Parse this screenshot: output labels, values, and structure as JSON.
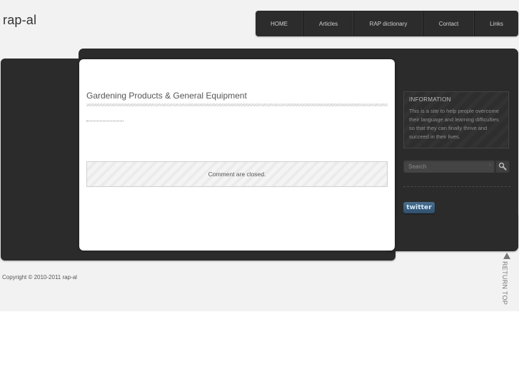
{
  "site": {
    "title": "rap-al"
  },
  "nav": {
    "items": [
      {
        "label": "HOME"
      },
      {
        "label": "Articles"
      },
      {
        "label": "RAP dictionary"
      },
      {
        "label": "Contact"
      },
      {
        "label": "Links"
      }
    ]
  },
  "post": {
    "title": "Gardening Products & General Equipment",
    "comments_status": "Comment are closed."
  },
  "sidebar": {
    "info_heading": "INFORMATION",
    "info_text": "This is a site to help people overcome their language and learning difficulties so that they can finally thrive and succeed in their lives.",
    "search_placeholder": "Search",
    "search_arrow": "›",
    "twitter_label": "twitter"
  },
  "footer": {
    "copyright": "Copyright ©  2010-2011  rap-al",
    "return_top": "RETURN TOP"
  },
  "colors": {
    "page_background": "#f2f2f2",
    "panel_dark": "#2b2b2b",
    "card": "#ffffff",
    "twitter_badge": "#3d6280"
  },
  "icons": {
    "search": "magnifier-icon",
    "return_top": "triangle-up-icon"
  }
}
